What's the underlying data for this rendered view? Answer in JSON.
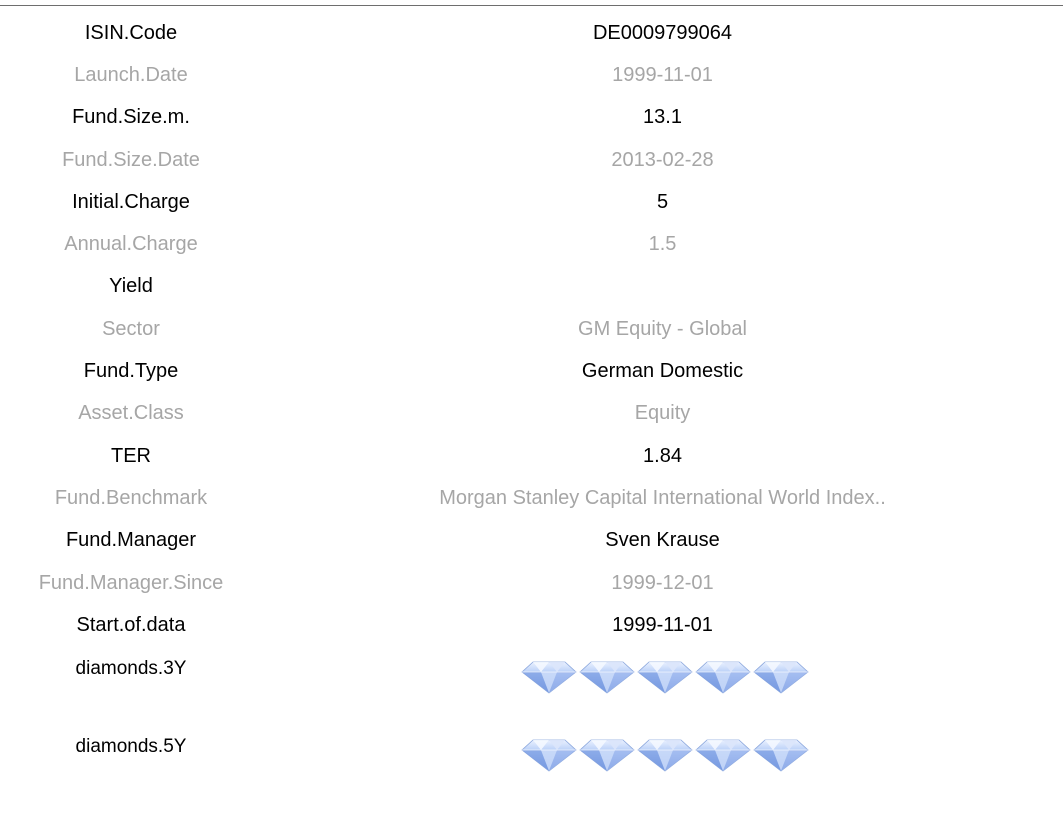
{
  "rows": [
    {
      "label": "ISIN.Code",
      "value": "DE0009799064"
    },
    {
      "label": "Launch.Date",
      "value": "1999-11-01"
    },
    {
      "label": "Fund.Size.m.",
      "value": "13.1"
    },
    {
      "label": "Fund.Size.Date",
      "value": "2013-02-28"
    },
    {
      "label": "Initial.Charge",
      "value": "5"
    },
    {
      "label": "Annual.Charge",
      "value": "1.5"
    },
    {
      "label": "Yield",
      "value": ""
    },
    {
      "label": "Sector",
      "value": "GM Equity - Global"
    },
    {
      "label": "Fund.Type",
      "value": "German Domestic"
    },
    {
      "label": "Asset.Class",
      "value": "Equity"
    },
    {
      "label": "TER",
      "value": "1.84"
    },
    {
      "label": "Fund.Benchmark",
      "value": "Morgan Stanley Capital International World Index.."
    },
    {
      "label": "Fund.Manager",
      "value": "Sven Krause"
    },
    {
      "label": "Fund.Manager.Since",
      "value": "1999-12-01"
    },
    {
      "label": "Start.of.data",
      "value": "1999-11-01"
    }
  ],
  "ratings": [
    {
      "label": "diamonds.3Y",
      "icon": "diamond-icon",
      "count": 5,
      "max": 5
    },
    {
      "label": "diamonds.5Y",
      "icon": "diamond-icon",
      "count": 5,
      "max": 5
    }
  ],
  "colors": {
    "text": "#000000",
    "muted": "#a6a6a6",
    "rule": "#6e6e6e"
  }
}
